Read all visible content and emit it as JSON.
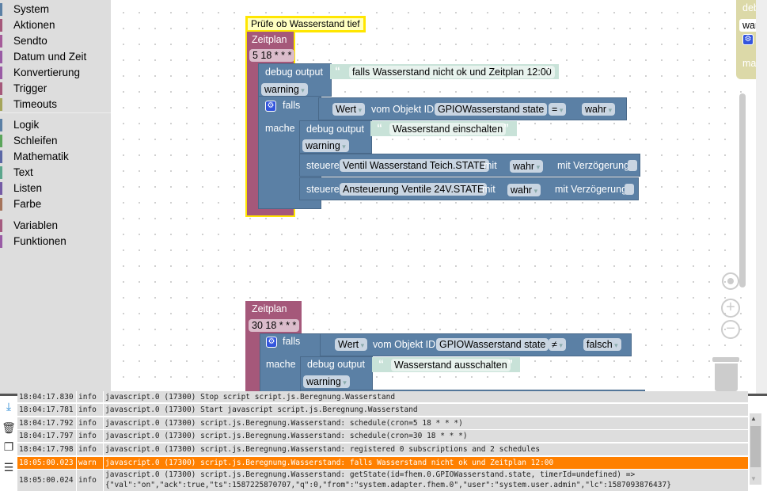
{
  "sidebar": {
    "groups": [
      [
        {
          "label": "System",
          "color": "#5b80a5"
        },
        {
          "label": "Aktionen",
          "color": "#a5587a"
        },
        {
          "label": "Sendto",
          "color": "#a55b99"
        },
        {
          "label": "Datum und Zeit",
          "color": "#995ba5"
        },
        {
          "label": "Konvertierung",
          "color": "#995ba5"
        },
        {
          "label": "Trigger",
          "color": "#a5587a"
        },
        {
          "label": "Timeouts",
          "color": "#a5a55b"
        }
      ],
      [
        {
          "label": "Logik",
          "color": "#5b80a5"
        },
        {
          "label": "Schleifen",
          "color": "#5ba55b"
        },
        {
          "label": "Mathematik",
          "color": "#5b67a5"
        },
        {
          "label": "Text",
          "color": "#5ba58c"
        },
        {
          "label": "Listen",
          "color": "#745ba5"
        },
        {
          "label": "Farbe",
          "color": "#a5745b"
        }
      ],
      [
        {
          "label": "Variablen",
          "color": "#a55b80"
        },
        {
          "label": "Funktionen",
          "color": "#995ba5"
        }
      ]
    ]
  },
  "workspace": {
    "block1": {
      "comment": "Prüfe ob Wasserstand tief",
      "schedule_label": "Zeitplan",
      "cron": "5 18 * * *",
      "debug1": {
        "label": "debug output",
        "text": "falls Wasserstand nicht ok und Zeitplan 12:00",
        "level": "warning"
      },
      "if": {
        "label": "falls",
        "do_label": "mache",
        "value": "Wert",
        "object_label": "vom Objekt ID",
        "object": "GPIOWasserstand state",
        "op": "=",
        "compare": "wahr"
      },
      "debug2": {
        "label": "debug output",
        "text": "Wasserstand einschalten",
        "level": "warning"
      },
      "control1": {
        "label": "steuere",
        "object": "Ventil Wasserstand Teich.STATE",
        "with": "mit",
        "value": "wahr",
        "delay": "mit Verzögerung"
      },
      "control2": {
        "label": "steuere",
        "object": "Ansteuerung Ventile 24V.STATE",
        "with": "mit",
        "value": "wahr",
        "delay": "mit Verzögerung"
      }
    },
    "block2": {
      "schedule_label": "Zeitplan",
      "cron": "30 18 * * *",
      "if": {
        "label": "falls",
        "do_label": "mache",
        "value": "Wert",
        "object_label": "vom Objekt ID",
        "object": "GPIOWasserstand state",
        "op": "≠",
        "compare": "falsch"
      },
      "debug": {
        "label": "debug output",
        "text": "Wasserstand ausschalten",
        "level": "warning"
      }
    },
    "ghost": {
      "debug": "debu",
      "level": "warn",
      "falls": "f",
      "do": "mach"
    },
    "block_color": "#5b80a5",
    "schedule_color": "#a5587a",
    "highlight": "#ffe600",
    "warn_color": "#ff8000"
  },
  "log": {
    "rows": [
      {
        "time": "18:04:17.830",
        "level": "info",
        "msg": "javascript.0 (17300) Stop script script.js.Beregnung.Wasserstand"
      },
      {
        "time": "18:04:17.781",
        "level": "info",
        "msg": "javascript.0 (17300) Start javascript script.js.Beregnung.Wasserstand"
      },
      {
        "time": "18:04:17.792",
        "level": "info",
        "msg": "javascript.0 (17300) script.js.Beregnung.Wasserstand: schedule(cron=5 18 * * *)"
      },
      {
        "time": "18:04:17.797",
        "level": "info",
        "msg": "javascript.0 (17300) script.js.Beregnung.Wasserstand: schedule(cron=30 18 * * *)"
      },
      {
        "time": "18:04:17.798",
        "level": "info",
        "msg": "javascript.0 (17300) script.js.Beregnung.Wasserstand: registered 0 subscriptions and 2 schedules"
      },
      {
        "time": "18:05:00.023",
        "level": "warn",
        "msg": "javascript.0 (17300) script.js.Beregnung.Wasserstand: falls Wasserstand nicht ok und Zeitplan 12:00"
      },
      {
        "time": "18:05:00.024",
        "level": "info",
        "msg": "javascript.0 (17300) script.js.Beregnung.Wasserstand: getState(id=fhem.0.GPIOWasserstand.state, timerId=undefined) =>",
        "msg2": "{\"val\":\"on\",\"ack\":true,\"ts\":1587225870707,\"q\":0,\"from\":\"system.adapter.fhem.0\",\"user\":\"system.user.admin\",\"lc\":1587093876437}"
      }
    ]
  }
}
